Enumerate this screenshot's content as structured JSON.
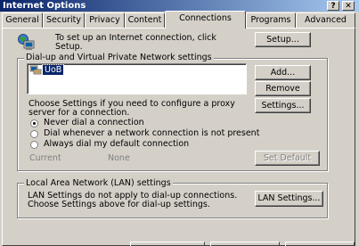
{
  "window": {
    "title": "Internet Options",
    "help_button": "?",
    "close_button": "✕"
  },
  "tabs": [
    {
      "label": "General"
    },
    {
      "label": "Security"
    },
    {
      "label": "Privacy"
    },
    {
      "label": "Content"
    },
    {
      "label": "Connections",
      "active": true
    },
    {
      "label": "Programs"
    },
    {
      "label": "Advanced"
    }
  ],
  "setup": {
    "text_line1": "To set up an Internet connection, click",
    "text_line2": "Setup.",
    "button": "Setup..."
  },
  "dialup": {
    "group_label": "Dial-up and Virtual Private Network settings",
    "list_items": [
      "UoB"
    ],
    "add_button": "Add...",
    "remove_button": "Remove",
    "settings_button": "Settings...",
    "proxy_text_line1": "Choose Settings if you need to configure a proxy",
    "proxy_text_line2": "server for a connection.",
    "radio_options": [
      {
        "label": "Never dial a connection",
        "selected": true
      },
      {
        "label": "Dial whenever a network connection is not present",
        "selected": false
      },
      {
        "label": "Always dial my default connection",
        "selected": false
      }
    ],
    "current_label": "Current",
    "current_value": "None",
    "set_default_button": "Set Default"
  },
  "lan": {
    "group_label": "Local Area Network (LAN) settings",
    "text_line1": "LAN Settings do not apply to dial-up connections.",
    "text_line2": "Choose Settings above for dial-up settings.",
    "button": "LAN Settings..."
  }
}
